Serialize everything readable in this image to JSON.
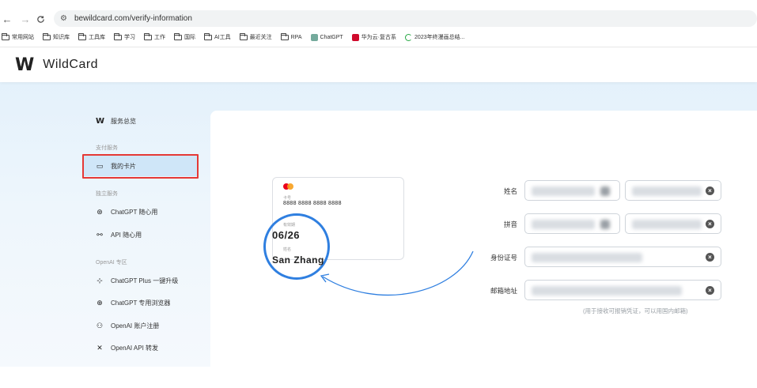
{
  "browser": {
    "back_icon": "←",
    "forward_icon": "→",
    "reload_icon": "C",
    "url": "bewildcard.com/verify-information",
    "bookmarks": [
      {
        "label": "常用网站",
        "kind": "folder"
      },
      {
        "label": "知识库",
        "kind": "folder"
      },
      {
        "label": "工具库",
        "kind": "folder"
      },
      {
        "label": "学习",
        "kind": "folder"
      },
      {
        "label": "工作",
        "kind": "folder"
      },
      {
        "label": "国际",
        "kind": "folder"
      },
      {
        "label": "AI工具",
        "kind": "folder"
      },
      {
        "label": "最近关注",
        "kind": "folder"
      },
      {
        "label": "RPA",
        "kind": "folder"
      },
      {
        "label": "ChatGPT",
        "kind": "site",
        "color": "#74aa9c"
      },
      {
        "label": "华为云·复古系",
        "kind": "site",
        "color": "#cf0a2c"
      },
      {
        "label": "2023年终漫画总结...",
        "kind": "site",
        "color": "#27a844"
      }
    ]
  },
  "header": {
    "logo": "W",
    "brand": "WildCard"
  },
  "sidebar": {
    "overview": {
      "icon": "W",
      "label": "服务总览"
    },
    "groups": [
      {
        "label": "支付服务"
      },
      {
        "label": "独立服务"
      },
      {
        "label": "OpenAI 专区"
      }
    ],
    "items": [
      {
        "icon": "▭",
        "label": "我的卡片",
        "active": true
      },
      {
        "icon": "⊛",
        "label": "ChatGPT 随心用"
      },
      {
        "icon": "⚯",
        "label": "API 随心用"
      },
      {
        "icon": "⊹",
        "label": "ChatGPT Plus 一键升级"
      },
      {
        "icon": "⊕",
        "label": "ChatGPT 专用浏览器"
      },
      {
        "icon": "⚇",
        "label": "OpenAI 账户注册"
      },
      {
        "icon": "✕",
        "label": "OpenAI API 转发"
      }
    ]
  },
  "card": {
    "number_label": "卡号",
    "number": "8888 8888 8888 8888",
    "expiry_label": "有效期",
    "expiry": "06/26",
    "name_label": "姓名",
    "name": "San Zhang"
  },
  "form": {
    "fields": [
      {
        "label": "姓名"
      },
      {
        "label": "拼音"
      },
      {
        "label": "身份证号"
      },
      {
        "label": "邮箱地址"
      }
    ],
    "note": "(用于接收可报销凭证，可以用国内邮箱)"
  },
  "colors": {
    "accent": "#2f7fe0",
    "highlight": "#e53935",
    "active_bg": "#cfe6f8"
  }
}
